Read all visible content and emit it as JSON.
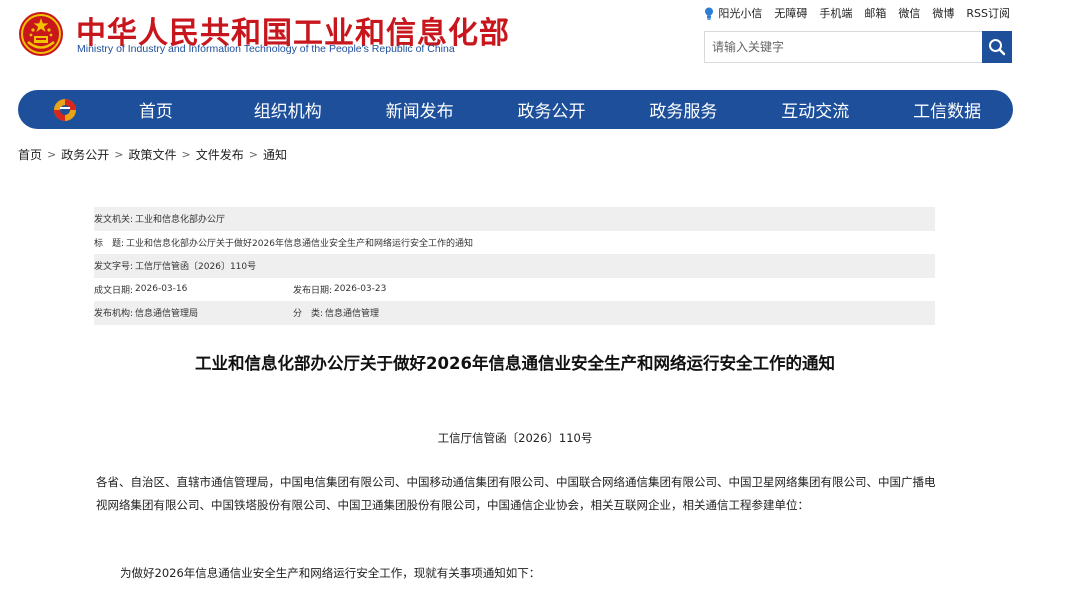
{
  "header": {
    "site_name_cn": "中华人民共和国工业和信息化部",
    "site_name_en": "Ministry of Industry and Information Technology of the People's Republic of China",
    "top_links": [
      {
        "label": "阳光小信",
        "icon": "lightbulb-icon"
      },
      {
        "label": "无障碍"
      },
      {
        "label": "手机端"
      },
      {
        "label": "邮箱"
      },
      {
        "label": "微信"
      },
      {
        "label": "微博"
      },
      {
        "label": "RSS订阅"
      }
    ],
    "search": {
      "placeholder": "请输入关键字",
      "icon": "search-icon"
    }
  },
  "nav": {
    "logo_icon": "miit-logo-icon",
    "items": [
      "首页",
      "组织机构",
      "新闻发布",
      "政务公开",
      "政务服务",
      "互动交流",
      "工信数据"
    ]
  },
  "breadcrumb": [
    "首页",
    "政务公开",
    "政策文件",
    "文件发布",
    "通知"
  ],
  "breadcrumb_separator": ">",
  "meta": {
    "issuer_label": "发文机关:",
    "issuer": "工业和信息化部办公厅",
    "title_label": "标　题:",
    "title": "工业和信息化部办公厅关于做好2026年信息通信业安全生产和网络运行安全工作的通知",
    "doc_no_label": "发文字号:",
    "doc_no": "工信厅信管函〔2026〕110号",
    "created_label": "成文日期:",
    "created": "2026-03-16",
    "published_label": "发布日期:",
    "published": "2026-03-23",
    "org_label": "发布机构:",
    "org": "信息通信管理局",
    "category_label": "分　类:",
    "category": "信息通信管理"
  },
  "article": {
    "title": "工业和信息化部办公厅关于做好2026年信息通信业安全生产和网络运行安全工作的通知",
    "doc_number": "工信厅信管函〔2026〕110号",
    "para1": "各省、自治区、直辖市通信管理局，中国电信集团有限公司、中国移动通信集团有限公司、中国联合网络通信集团有限公司、中国卫星网络集团有限公司、中国广播电视网络集团有限公司、中国铁塔股份有限公司、中国卫通集团股份有限公司，中国通信企业协会，相关互联网企业，相关通信工程参建单位：",
    "para2": "为做好2026年信息通信业安全生产和网络运行安全工作，现就有关事项通知如下："
  },
  "colors": {
    "brand_red": "#c8161d",
    "brand_blue": "#1d4f9b",
    "meta_shade": "#efefef"
  }
}
